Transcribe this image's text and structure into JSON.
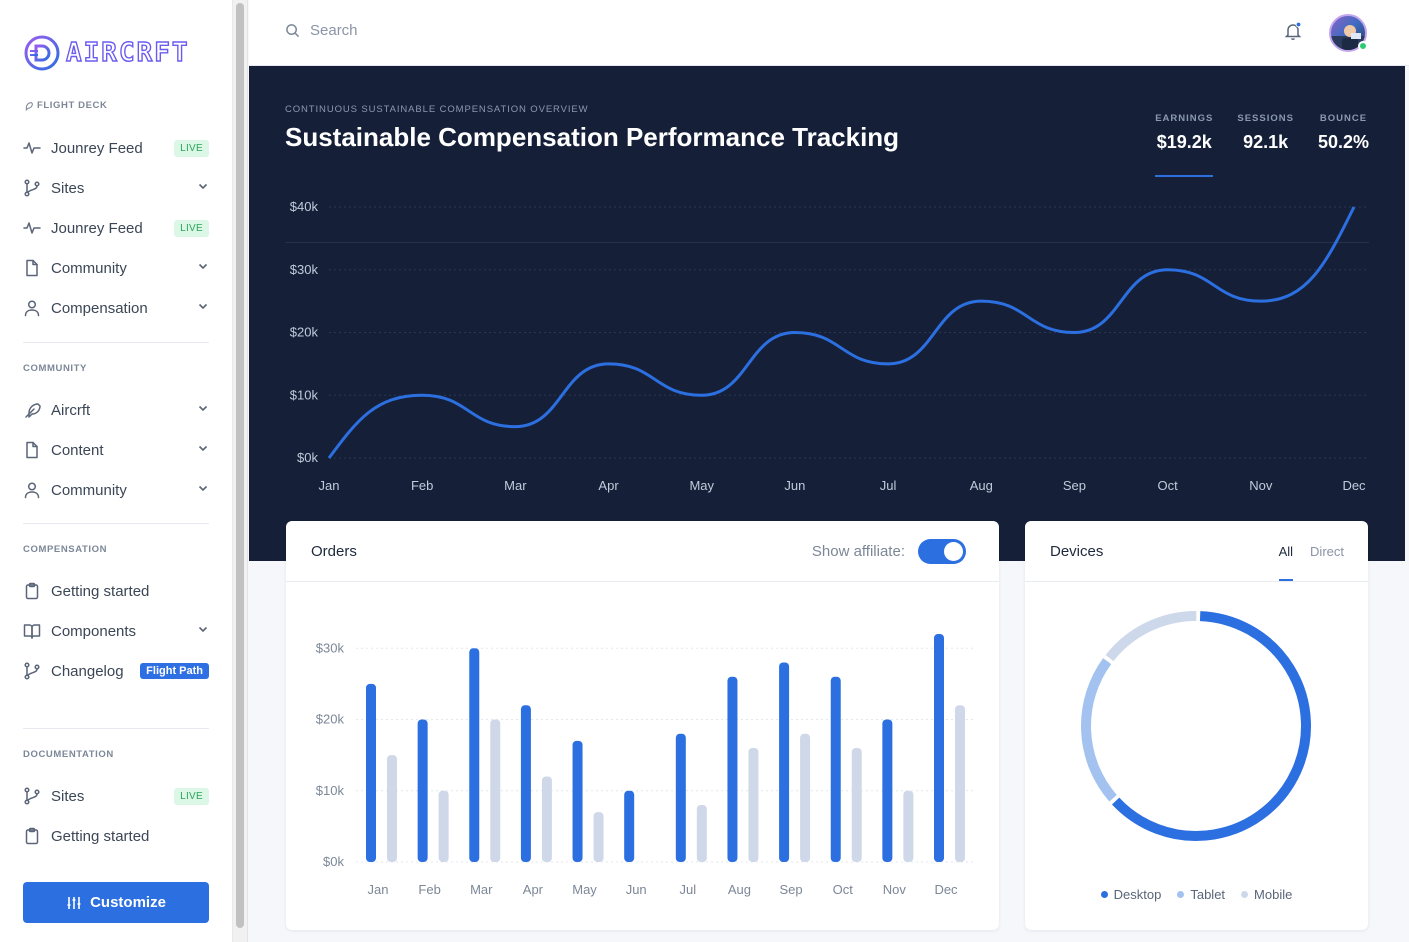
{
  "brand": {
    "name": "AIRCRFT"
  },
  "sidebar": {
    "sections": [
      {
        "label": "Flight Deck",
        "items": [
          {
            "label": "Jounrey Feed",
            "icon": "activity-icon",
            "badge": "LIVE"
          },
          {
            "label": "Sites",
            "icon": "git-branch-icon",
            "chevron": true
          },
          {
            "label": "Jounrey Feed",
            "icon": "activity-icon",
            "badge": "LIVE"
          },
          {
            "label": "Community",
            "icon": "file-icon",
            "chevron": true
          },
          {
            "label": "Compensation",
            "icon": "user-icon",
            "chevron": true
          }
        ]
      },
      {
        "label": "Community",
        "items": [
          {
            "label": "Aircrft",
            "icon": "feather-icon",
            "chevron": true
          },
          {
            "label": "Content",
            "icon": "file-icon",
            "chevron": true
          },
          {
            "label": "Community",
            "icon": "user-icon",
            "chevron": true
          }
        ]
      },
      {
        "label": "Compensation",
        "items": [
          {
            "label": "Getting started",
            "icon": "clipboard-icon"
          },
          {
            "label": "Components",
            "icon": "book-icon",
            "chevron": true
          },
          {
            "label": "Changelog",
            "icon": "git-branch-icon",
            "badge": "Flight Path"
          }
        ]
      },
      {
        "label": "Documentation",
        "items": [
          {
            "label": "Sites",
            "icon": "git-branch-icon",
            "badge": "LIVE"
          },
          {
            "label": "Getting started",
            "icon": "clipboard-icon"
          }
        ]
      }
    ],
    "customize_label": "Customize"
  },
  "header": {
    "search_placeholder": "Search"
  },
  "hero": {
    "eyebrow": "Continuous Sustainable Compensation Overview",
    "title": "Sustainable Compensation Performance Tracking",
    "kpis": [
      {
        "label": "EARNINGS",
        "value": "$19.2k",
        "active": true
      },
      {
        "label": "SESSIONS",
        "value": "92.1k",
        "active": false
      },
      {
        "label": "BOUNCE",
        "value": "50.2%",
        "active": false
      }
    ]
  },
  "orders": {
    "title": "Orders",
    "toggle_label": "Show affiliate:",
    "toggle_on": true
  },
  "devices": {
    "title": "Devices",
    "tabs": [
      "All",
      "Direct"
    ],
    "active_tab": 0
  },
  "colors": {
    "primary": "#2c6fe0",
    "hero_bg": "#152038",
    "secondary_bar": "#cfd8e8",
    "tablet": "#a3c2f0",
    "mobile": "#cdd8ea"
  },
  "chart_data": [
    {
      "type": "line",
      "name": "hero-earnings",
      "x": [
        "Jan",
        "Feb",
        "Mar",
        "Apr",
        "May",
        "Jun",
        "Jul",
        "Aug",
        "Sep",
        "Oct",
        "Nov",
        "Dec"
      ],
      "series": [
        {
          "values": [
            0,
            10000,
            5000,
            15000,
            10000,
            20000,
            15000,
            25000,
            20000,
            30000,
            25000,
            40000
          ]
        }
      ],
      "yticks": [
        "$0k",
        "$10k",
        "$20k",
        "$30k",
        "$40k"
      ],
      "ylim": [
        0,
        40000
      ],
      "grid": true
    },
    {
      "type": "bar",
      "name": "orders",
      "categories": [
        "Jan",
        "Feb",
        "Mar",
        "Apr",
        "May",
        "Jun",
        "Jul",
        "Aug",
        "Sep",
        "Oct",
        "Nov",
        "Dec"
      ],
      "series": [
        {
          "values": [
            25000,
            20000,
            30000,
            22000,
            17000,
            10000,
            18000,
            26000,
            28000,
            26000,
            20000,
            32000
          ]
        },
        {
          "values": [
            15000,
            10000,
            20000,
            12000,
            7000,
            0,
            8000,
            16000,
            18000,
            16000,
            10000,
            22000
          ]
        }
      ],
      "yticks": [
        "$0k",
        "$10k",
        "$20k",
        "$30k"
      ],
      "ylim": [
        0,
        32000
      ],
      "grid": true
    },
    {
      "type": "pie",
      "name": "devices",
      "categories": [
        "Desktop",
        "Tablet",
        "Mobile"
      ],
      "values": [
        63,
        22,
        15
      ]
    }
  ]
}
